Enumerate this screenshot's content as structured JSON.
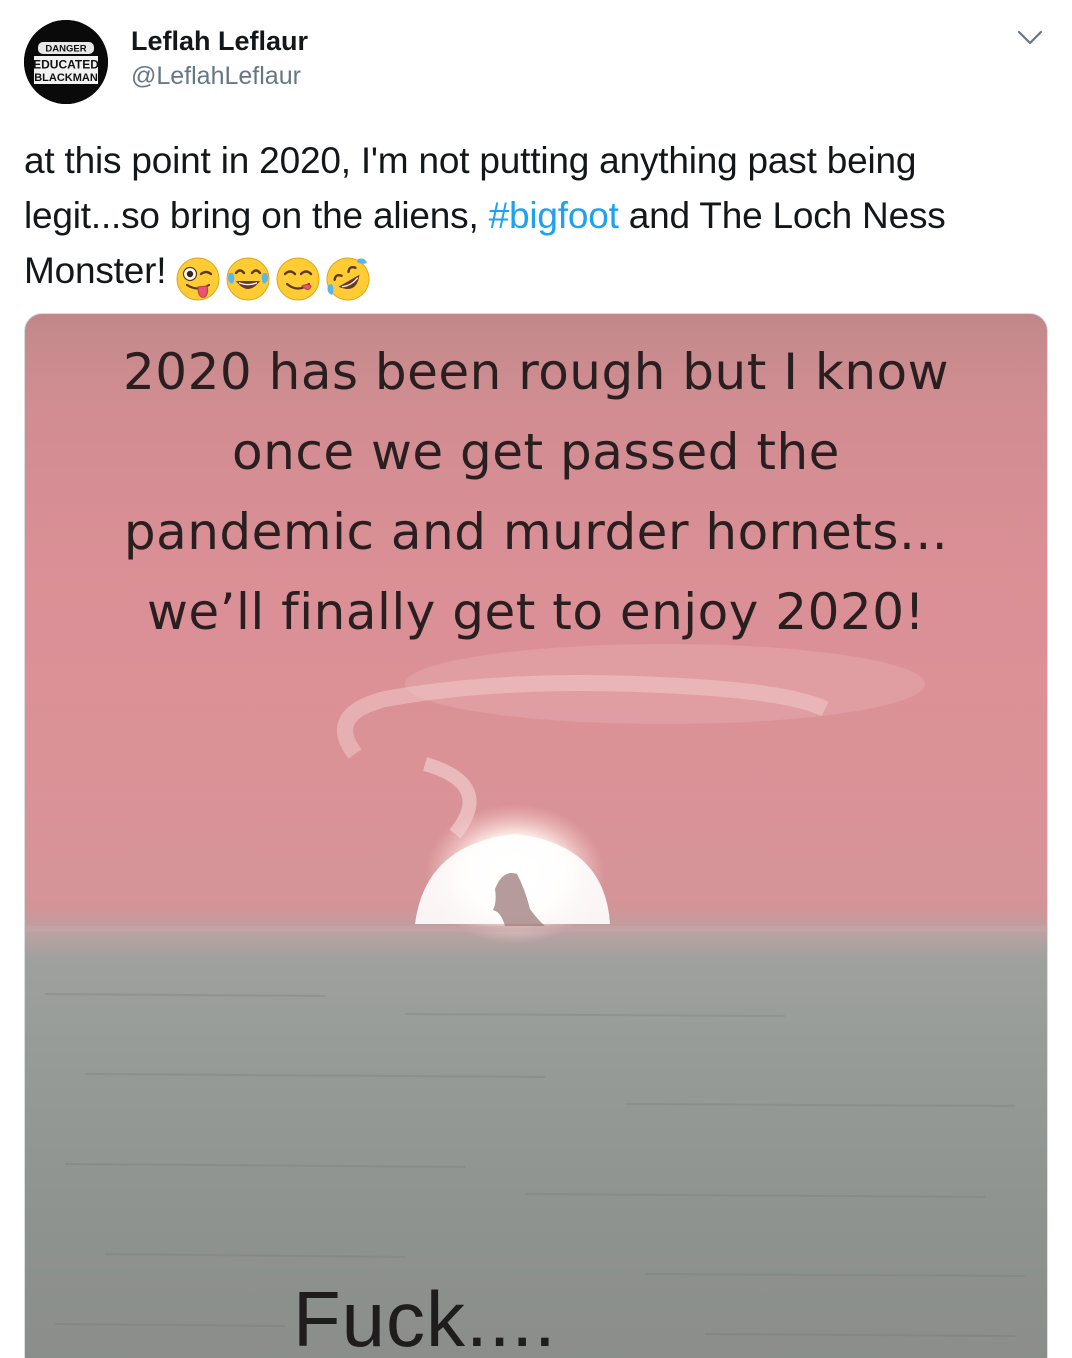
{
  "tweet": {
    "display_name": "Leflah Leflaur",
    "handle": "@LeflahLeflaur",
    "avatar_text": [
      "DANGER",
      "EDUCATED",
      "BLACKMAN"
    ],
    "text_before_hashtag": "at this point in 2020, I'm not putting anything past being legit...so bring on the aliens, ",
    "hashtag": "#bigfoot",
    "text_after_hashtag": " and The Loch Ness Monster!",
    "emojis": [
      "winking-face-with-tongue",
      "face-with-tears-of-joy",
      "face-savoring-food",
      "rolling-on-the-floor-laughing"
    ],
    "accent_color": "#1da1f2"
  },
  "media": {
    "meme_lines": [
      "2020 has been rough but I know",
      "once we get passed the",
      "pandemic and murder hornets...",
      "we’ll finally get to enjoy 2020!"
    ],
    "punchline": "Fuck...."
  }
}
